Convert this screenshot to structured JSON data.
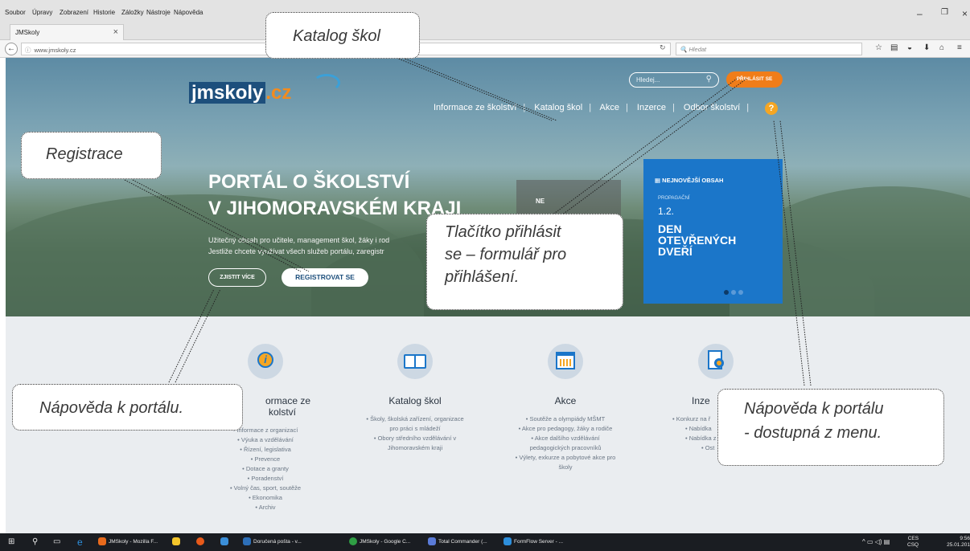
{
  "browser": {
    "menu": [
      "Soubor",
      "Úpravy",
      "Zobrazení",
      "Historie",
      "Záložky",
      "Nástroje",
      "Nápověda"
    ],
    "tab_title": "JMSkoly",
    "tab_close": "×",
    "new_tab": "+",
    "url": "www.jmskoly.cz",
    "search_placeholder": "Hledat"
  },
  "site": {
    "logo_main": "jmskoly",
    "logo_tld": ".cz",
    "search_placeholder": "Hledej...",
    "login_label": "PŘIHLÁSIT SE",
    "nav": [
      "Informace ze školství",
      "Katalog škol",
      "Akce",
      "Inzerce",
      "Odbor školství"
    ],
    "help_label": "?",
    "hero_title_1": "PORTÁL O ŠKOLSTVÍ",
    "hero_title_2": "V JIHOMORAVSKÉM KRAJI",
    "hero_text_1": "Užitečný obsah pro učitele, management škol, žáky i rod",
    "hero_text_2": "Jestliže chcete využívat všech služeb portálu, zaregistr",
    "btn_more": "ZJISTIT VÍCE",
    "btn_register": "REGISTROVAT SE",
    "gray_box_label": "NE",
    "latest": {
      "heading": "NEJNOVĚJŠÍ OBSAH",
      "tag": "PROPAGAČNÍ",
      "date": "1.2.",
      "title": [
        "DEN",
        "OTEVŘENÝCH",
        "DVEŘÍ"
      ]
    }
  },
  "sections": [
    {
      "title": "Informace ze školství",
      "title_visible": "ormace ze",
      "title_visible_2": "kolství",
      "items": [
        "Informace z organizací",
        "Výuka a vzdělávání",
        "Řízení, legislativa",
        "Prevence",
        "Dotace a granty",
        "Poradenství",
        "Volný čas, sport, soutěže",
        "Ekonomika",
        "Archiv"
      ]
    },
    {
      "title": "Katalog škol",
      "items": [
        "Školy, školská zařízení, organizace pro práci s mládeží",
        "Obory středního vzdělávání v Jihomoravském kraji"
      ]
    },
    {
      "title": "Akce",
      "items": [
        "Soutěže a olympiády MŠMT",
        "Akce pro pedagogy, žáky a rodiče",
        "Akce dalšího vzdělávání pedagogických pracovníků",
        "Výlety, exkurze a pobytové akce pro školy"
      ]
    },
    {
      "title": "Inzerce",
      "title_visible": "Inze",
      "items": [
        "Konkurz na ř",
        "Nabídka",
        "Nabídka z",
        "Ost"
      ]
    }
  ],
  "annotations": {
    "katalog": "Katalog škol",
    "registrace": "Registrace",
    "login_1": "Tlačítko přihlásit",
    "login_2": "se – formulář pro",
    "login_3": "přihlášení.",
    "help_portal": "Nápověda k portálu.",
    "help_menu_1": "Nápověda k portálu",
    "help_menu_2": "- dostupná z menu."
  },
  "taskbar": {
    "apps": [
      "JMSkoly - Mozilla F...",
      "Doručená pošta - v...",
      "JMSkoly - Google C...",
      "Total Commander (...",
      "FormFlow Server - ..."
    ],
    "lang": "CES",
    "lang2": "CSQ",
    "time": "9:56",
    "date": "25.01.201"
  }
}
